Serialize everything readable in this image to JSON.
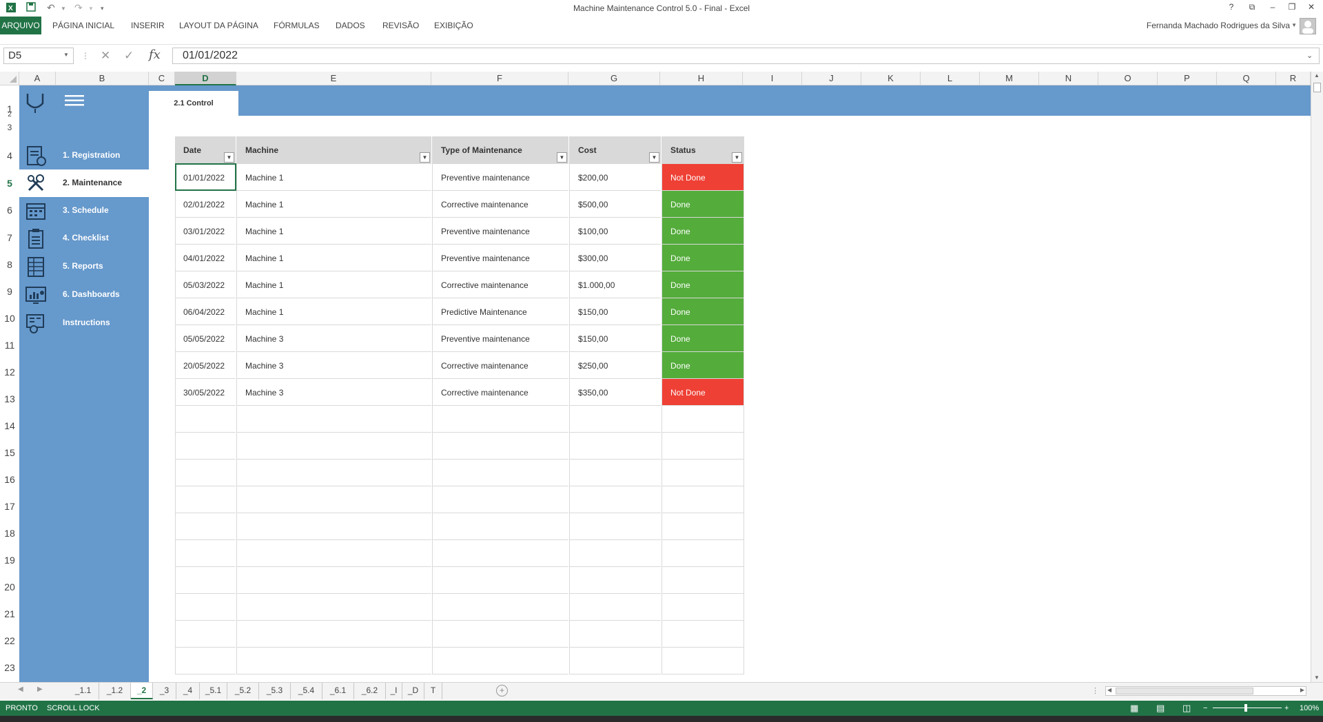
{
  "window": {
    "title": "Machine Maintenance Control 5.0 - Final - Excel",
    "help": "?",
    "minimize": "–",
    "restore": "❐",
    "close": "✕"
  },
  "ribbon": {
    "file_tab": "ARQUIVO",
    "tabs": [
      "PÁGINA INICIAL",
      "INSERIR",
      "LAYOUT DA PÁGINA",
      "FÓRMULAS",
      "DADOS",
      "REVISÃO",
      "EXIBIÇÃO"
    ],
    "user": "Fernanda Machado Rodrigues da Silva"
  },
  "formula_bar": {
    "name_box": "D5",
    "formula": "01/01/2022",
    "fx": "fx"
  },
  "columns": [
    "A",
    "B",
    "C",
    "D",
    "E",
    "F",
    "G",
    "H",
    "I",
    "J",
    "K",
    "L",
    "M",
    "N",
    "O",
    "P",
    "Q",
    "R"
  ],
  "rows": [
    "1",
    "2",
    "3",
    "4",
    "5",
    "6",
    "7",
    "8",
    "9",
    "10",
    "11",
    "12",
    "13",
    "14",
    "15",
    "16",
    "17",
    "18",
    "19",
    "20",
    "21",
    "22",
    "23"
  ],
  "sheet": {
    "control_tab": "2.1 Control",
    "nav": [
      {
        "label": "1. Registration",
        "icon": "registration-icon"
      },
      {
        "label": "2. Maintenance",
        "icon": "maintenance-icon"
      },
      {
        "label": "3. Schedule",
        "icon": "calendar-icon"
      },
      {
        "label": "4. Checklist",
        "icon": "checklist-icon"
      },
      {
        "label": "5. Reports",
        "icon": "report-icon"
      },
      {
        "label": "6. Dashboards",
        "icon": "dashboard-icon"
      },
      {
        "label": "Instructions",
        "icon": "instructions-icon"
      }
    ]
  },
  "table": {
    "headers": [
      "Date",
      "Machine",
      "Type of Maintenance",
      "Cost",
      "Status"
    ],
    "rows": [
      [
        "01/01/2022",
        "Machine 1",
        "Preventive maintenance",
        "$200,00",
        "Not Done"
      ],
      [
        "02/01/2022",
        "Machine 1",
        "Corrective maintenance",
        "$500,00",
        "Done"
      ],
      [
        "03/01/2022",
        "Machine 1",
        "Preventive maintenance",
        "$100,00",
        "Done"
      ],
      [
        "04/01/2022",
        "Machine 1",
        "Preventive maintenance",
        "$300,00",
        "Done"
      ],
      [
        "05/03/2022",
        "Machine 1",
        "Corrective maintenance",
        "$1.000,00",
        "Done"
      ],
      [
        "06/04/2022",
        "Machine 1",
        "Predictive Maintenance",
        "$150,00",
        "Done"
      ],
      [
        "05/05/2022",
        "Machine 3",
        "Preventive maintenance",
        "$150,00",
        "Done"
      ],
      [
        "20/05/2022",
        "Machine 3",
        "Corrective maintenance",
        "$250,00",
        "Done"
      ],
      [
        "30/05/2022",
        "Machine 3",
        "Corrective maintenance",
        "$350,00",
        "Not Done"
      ]
    ],
    "colors": {
      "done": "#54ac3b",
      "not_done": "#ef4035",
      "header": "#d9d9d9"
    }
  },
  "sheet_tabs": [
    "_1.1",
    "_1.2",
    "_2",
    "_3",
    "_4",
    "_5.1",
    "_5.2",
    "_5.3",
    "_5.4",
    "_6.1",
    "_6.2",
    "_I",
    "_D",
    "T"
  ],
  "active_sheet": "_2",
  "status_bar": {
    "ready": "PRONTO",
    "scroll_lock": "SCROLL LOCK",
    "zoom": "100%"
  },
  "colors": {
    "excel_green": "#217346",
    "sidebar_blue": "#6699cc"
  }
}
